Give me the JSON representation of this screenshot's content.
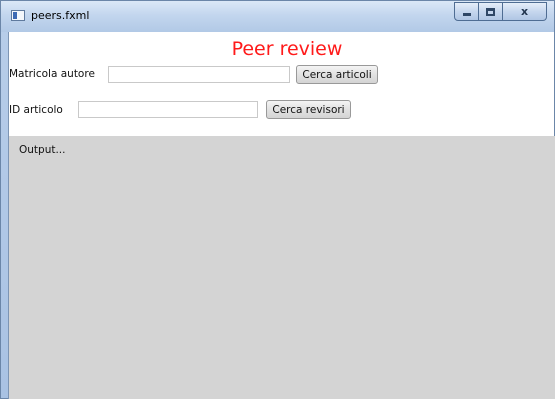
{
  "window": {
    "title": "peers.fxml"
  },
  "controls": {
    "minimize_icon": "minimize-icon",
    "maximize_icon": "maximize-icon",
    "close_label": "x"
  },
  "main": {
    "heading": "Peer review",
    "heading_color": "#ff1a1a",
    "author_label": "Matricola autore",
    "author_value": "",
    "search_articles_label": "Cerca articoli",
    "article_label": "ID articolo",
    "article_value": "",
    "search_reviewers_label": "Cerca revisori",
    "output_text": "Output..."
  }
}
